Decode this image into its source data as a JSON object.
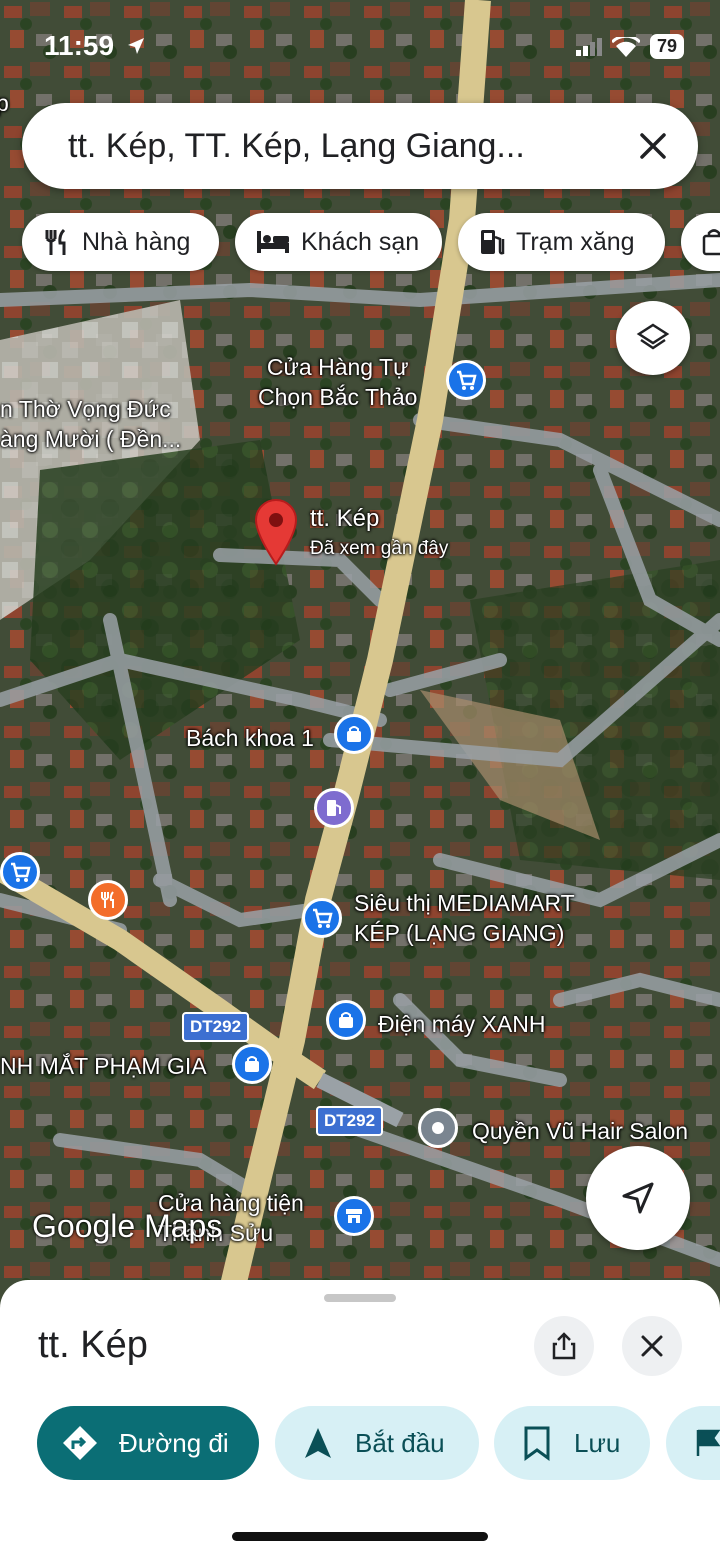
{
  "status_bar": {
    "time": "11:59",
    "battery": "79"
  },
  "search": {
    "query": "tt. Kép, TT. Kép, Lạng Giang..."
  },
  "chips": [
    {
      "label": "Nhà hàng",
      "icon": "restaurant-icon"
    },
    {
      "label": "Khách sạn",
      "icon": "hotel-icon"
    },
    {
      "label": "Trạm xăng",
      "icon": "gas-station-icon"
    }
  ],
  "map": {
    "places": {
      "store_bac_thao": "Cửa Hàng Tự\nChọn Bắc Thảo",
      "temple": "n Thờ Vọng Đức\nàng Mười ( Đền...",
      "selected_name": "tt. Kép",
      "selected_sub": "Đã xem gần đây",
      "bach_khoa": "Bách khoa 1",
      "mediamart": "Siêu thị MEDIAMART\nKÉP (LẠNG GIANG)",
      "dien_may_xanh": "Điện máy XANH",
      "pham_gia": "NH MẮT PHẠM GIA",
      "hair_salon": "Quyền Vũ Hair Salon",
      "cua_hang_tien": "Cửa hàng tiện\nThành Sửu"
    },
    "road_badges": [
      "DT292",
      "DT292"
    ],
    "watermark": "Google Maps",
    "left_edge": "p"
  },
  "sheet": {
    "title": "tt. Kép",
    "actions": [
      {
        "label": "Đường đi",
        "primary": true
      },
      {
        "label": "Bắt đầu",
        "primary": false
      },
      {
        "label": "Lưu",
        "primary": false
      }
    ]
  },
  "colors": {
    "primary": "#0b6e75",
    "secondary_bg": "#d7f0f5",
    "pin_shop": "#1a73e8",
    "pin_food": "#f36d2a",
    "pin_gas": "#7e6ccf",
    "marker": "#e53935"
  }
}
